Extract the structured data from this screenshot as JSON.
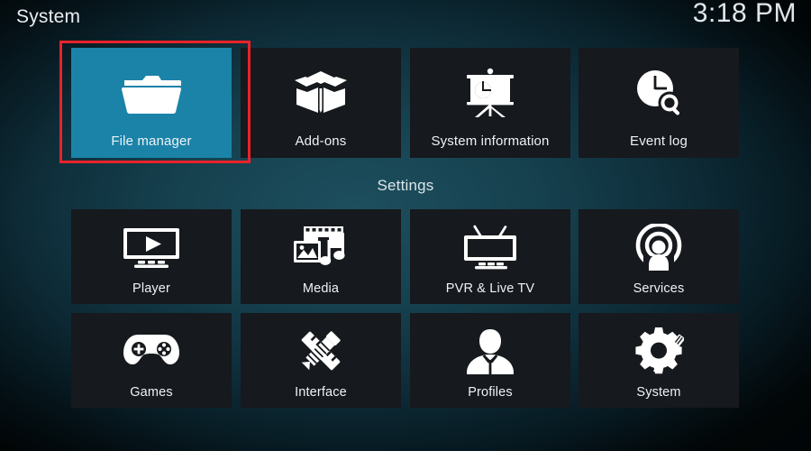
{
  "header": {
    "title": "System",
    "clock": "3:18 PM"
  },
  "section": {
    "settings_label": "Settings"
  },
  "colors": {
    "selected_tile": "#1b83a8",
    "tile": "#16191d",
    "highlight_box": "#e8232a",
    "text": "#eef3f6"
  },
  "rows": {
    "top": [
      {
        "label": "File manager",
        "icon": "folder-icon",
        "selected": true
      },
      {
        "label": "Add-ons",
        "icon": "open-box-icon",
        "selected": false
      },
      {
        "label": "System information",
        "icon": "presentation-chart-icon",
        "selected": false
      },
      {
        "label": "Event log",
        "icon": "clock-search-icon",
        "selected": false
      }
    ],
    "middle": [
      {
        "label": "Player",
        "icon": "monitor-play-icon",
        "selected": false
      },
      {
        "label": "Media",
        "icon": "film-photo-music-icon",
        "selected": false
      },
      {
        "label": "PVR & Live TV",
        "icon": "tv-antenna-icon",
        "selected": false
      },
      {
        "label": "Services",
        "icon": "broadcast-person-icon",
        "selected": false
      }
    ],
    "bottom": [
      {
        "label": "Games",
        "icon": "gamepad-icon",
        "selected": false
      },
      {
        "label": "Interface",
        "icon": "pencil-ruler-icon",
        "selected": false
      },
      {
        "label": "Profiles",
        "icon": "person-bust-icon",
        "selected": false
      },
      {
        "label": "System",
        "icon": "gear-screwdriver-icon",
        "selected": false
      }
    ]
  }
}
